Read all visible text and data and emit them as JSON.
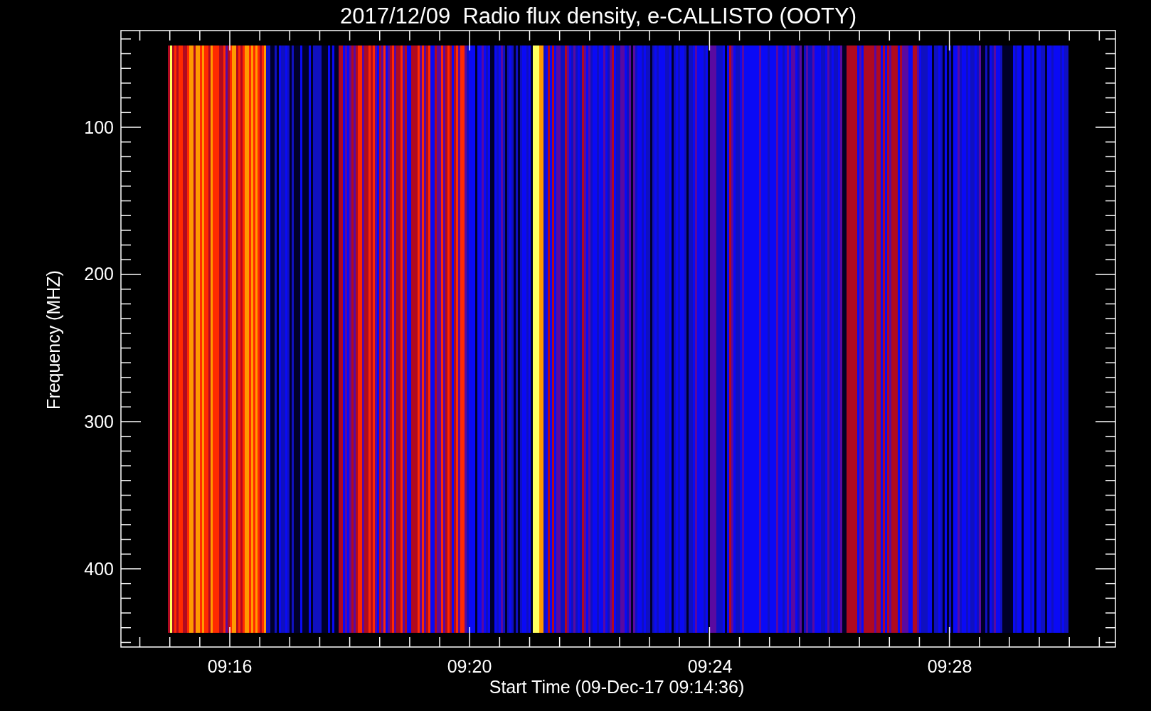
{
  "title": "2017/12/09  Radio flux density, e-CALLISTO (OOTY)",
  "y_axis": {
    "label": "Frequency (MHZ)",
    "ticks": [
      "100",
      "200",
      "300",
      "400"
    ]
  },
  "x_axis": {
    "label": "Start Time (09-Dec-17 09:14:36)",
    "ticks": [
      "09:16",
      "09:20",
      "09:24",
      "09:28"
    ]
  }
}
